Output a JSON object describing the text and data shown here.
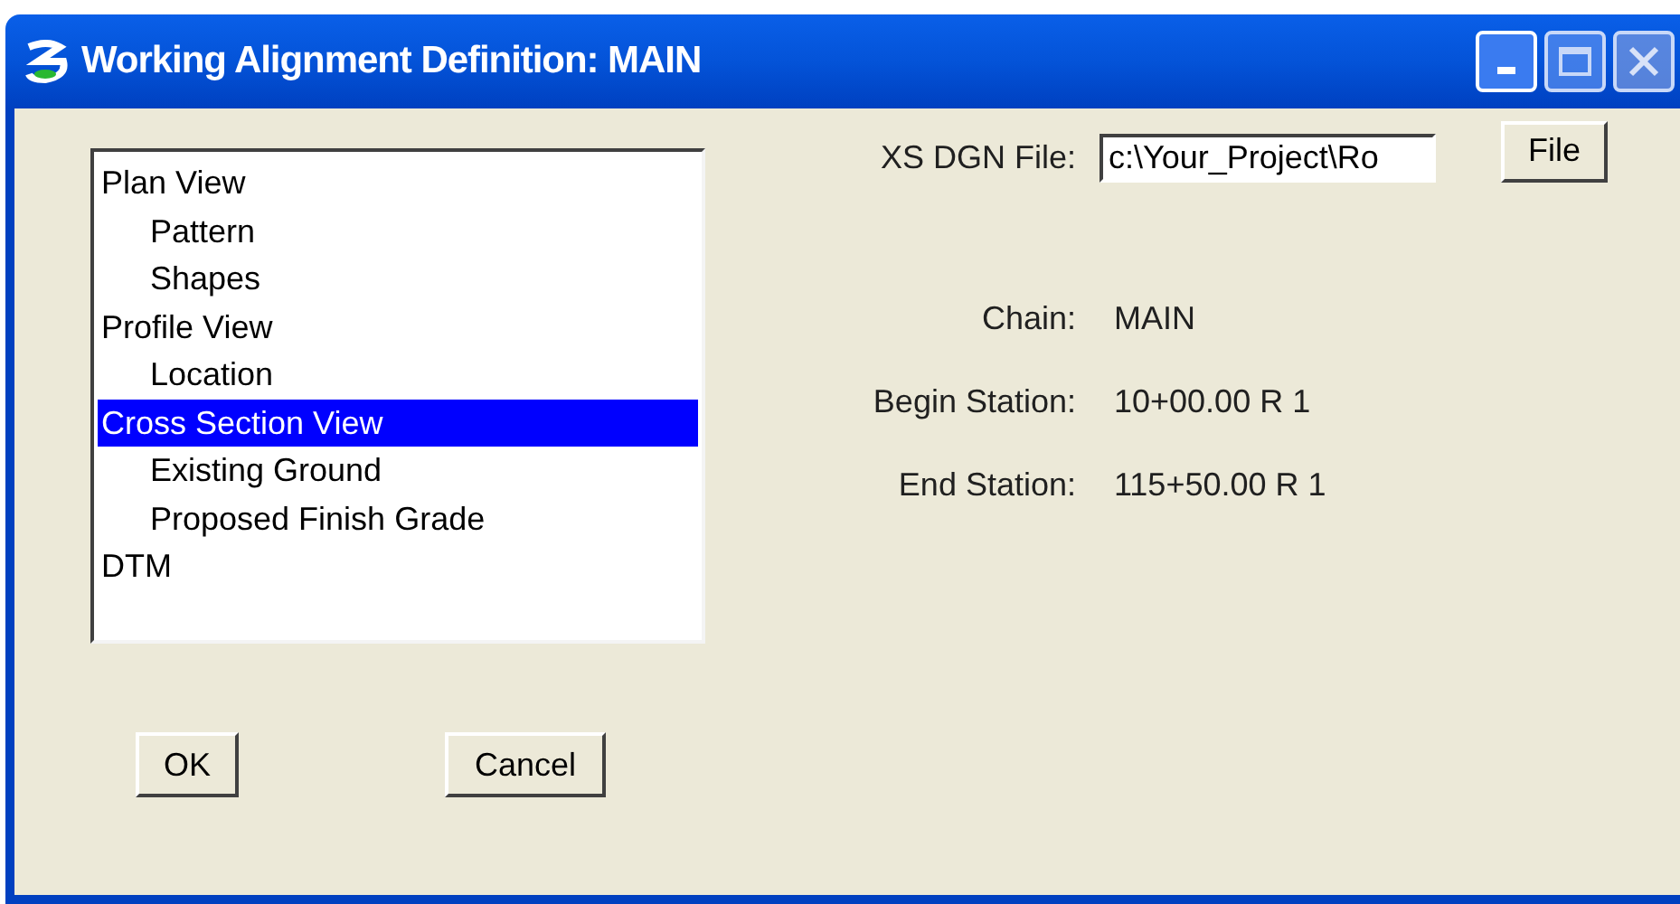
{
  "window": {
    "title": "Working Alignment Definition: MAIN"
  },
  "tree": [
    {
      "label": "Plan View",
      "selected": false,
      "children": [
        {
          "label": "Pattern",
          "selected": false
        },
        {
          "label": "Shapes",
          "selected": false
        }
      ]
    },
    {
      "label": "Profile View",
      "selected": false,
      "children": [
        {
          "label": "Location",
          "selected": false
        }
      ]
    },
    {
      "label": "Cross Section View",
      "selected": true,
      "children": [
        {
          "label": "Existing Ground",
          "selected": false
        },
        {
          "label": "Proposed Finish Grade",
          "selected": false
        }
      ]
    },
    {
      "label": "DTM",
      "selected": false
    }
  ],
  "xs_dgn_file": {
    "label": "XS DGN File:",
    "value": "c:\\Your_Project\\Ro"
  },
  "file_button": "File",
  "fields": [
    {
      "label": "Chain:",
      "value": "MAIN"
    },
    {
      "label": "Begin Station:",
      "value": "10+00.00 R 1"
    },
    {
      "label": "End Station:",
      "value": "115+50.00 R 1"
    }
  ],
  "buttons": [
    "OK",
    "Cancel"
  ]
}
